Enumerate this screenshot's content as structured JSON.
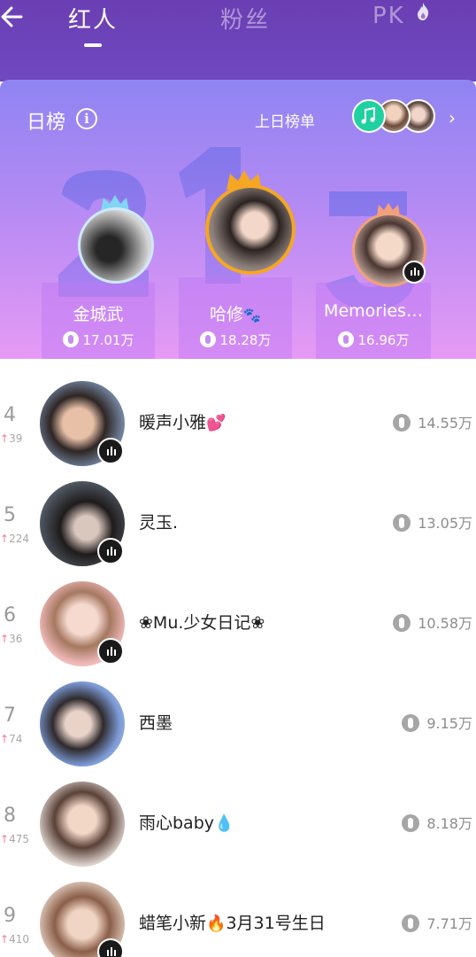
{
  "header": {
    "tabs": [
      {
        "label": "红人",
        "active": true
      },
      {
        "label": "粉丝",
        "active": false
      },
      {
        "label": "PK",
        "active": false
      }
    ]
  },
  "board": {
    "title": "日榜",
    "info_icon": "i",
    "prev_link": "上日榜单",
    "chevron": "›",
    "podium": [
      {
        "rank": "2",
        "name": "金城武",
        "score": "17.01万"
      },
      {
        "rank": "1",
        "name": "哈修",
        "name_emoji": "🐾",
        "score": "18.28万"
      },
      {
        "rank": "3",
        "name": "Memories…",
        "score": "16.96万"
      }
    ]
  },
  "list": [
    {
      "rank": "4",
      "delta": "39",
      "name": "暖声小雅",
      "emoji": "💕",
      "score": "14.55万",
      "live": true
    },
    {
      "rank": "5",
      "delta": "224",
      "name": "灵玉.",
      "emoji": "",
      "score": "13.05万",
      "live": true
    },
    {
      "rank": "6",
      "delta": "36",
      "name": "❀Mu.少女日记❀",
      "emoji": "",
      "score": "10.58万",
      "live": true
    },
    {
      "rank": "7",
      "delta": "74",
      "name": "西墨",
      "emoji": "",
      "score": "9.15万",
      "live": false
    },
    {
      "rank": "8",
      "delta": "475",
      "name": "雨心baby",
      "emoji": "💧",
      "score": "8.18万",
      "live": false
    },
    {
      "rank": "9",
      "delta": "410",
      "name": "蜡笔小新",
      "emoji": "🔥",
      "name_suffix": "3月31号生日",
      "score": "7.71万",
      "live": true
    }
  ],
  "colors": {
    "header_bg": "#6b3fb3",
    "board_gradient_top": "#8f84f2",
    "board_gradient_bottom": "#e69af5",
    "crown_gold": "#f5a623",
    "music_badge": "#1fd1a1",
    "rank_up": "#f07c93"
  },
  "icons": [
    "back-arrow-icon",
    "info-icon",
    "music-note-icon",
    "chevron-right-icon",
    "crown-icon",
    "live-icon",
    "coin-icon",
    "rank-up-arrow-icon",
    "flame-icon"
  ]
}
